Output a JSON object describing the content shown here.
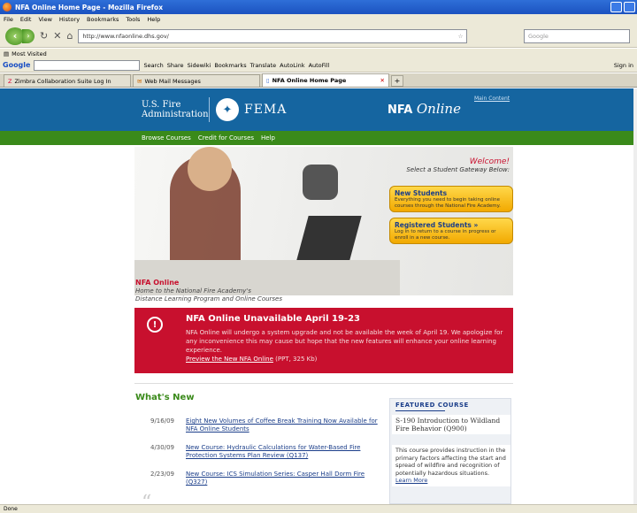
{
  "window": {
    "title": "NFA Online Home Page - Mozilla Firefox"
  },
  "menu": [
    "File",
    "Edit",
    "View",
    "History",
    "Bookmarks",
    "Tools",
    "Help"
  ],
  "nav": {
    "url": "http://www.nfaonline.dhs.gov/",
    "search_placeholder": "Google"
  },
  "bookmarks": {
    "most_visited": "Most Visited"
  },
  "googlebar": {
    "logo": "Google",
    "tools": [
      "Search",
      "Share",
      "Sidewiki",
      "Bookmarks",
      "Translate",
      "AutoLink",
      "AutoFill"
    ],
    "signin": "Sign in"
  },
  "tabs": [
    {
      "label": "Zimbra Collaboration Suite Log In"
    },
    {
      "label": "Web Mail Messages"
    },
    {
      "label": "NFA Online Home Page"
    }
  ],
  "header": {
    "usfire_line1": "U.S. Fire",
    "usfire_line2": "Administration",
    "fema": "FEMA",
    "nfa_prefix": "NFA",
    "nfa_online": "Online",
    "main_content": "Main Content"
  },
  "greennav": [
    "Browse Courses",
    "Credit for Courses",
    "Help"
  ],
  "hero": {
    "welcome": "Welcome!",
    "gateway": "Select a Student Gateway Below:",
    "new_students_title": "New Students",
    "new_students_desc": "Everything you need to begin taking online courses through the National Fire Academy.",
    "registered_title": "Registered Students »",
    "registered_desc": "Log in to return to a course in progress or enroll in a new course.",
    "nfa_online": "NFA Online",
    "sub_line1": "Home to the National Fire Academy's",
    "sub_line2": "Distance Learning Program and Online Courses"
  },
  "alert": {
    "icon": "!",
    "title": "NFA Online Unavailable April 19-23",
    "body": "NFA Online will undergo a system upgrade and not be available the week of April 19. We apologize for any inconvenience this may cause but hope that the new features will enhance your online learning experience.",
    "link": "Preview the New NFA Online",
    "link_suffix": " (PPT, 325 Kb)"
  },
  "whats_new": {
    "title": "What's New",
    "items": [
      {
        "date": "9/16/09",
        "text": "Eight New Volumes of Coffee Break Training Now Available for NFA Online Students"
      },
      {
        "date": "4/30/09",
        "text": "New Course: Hydraulic Calculations for Water-Based Fire Protection Systems Plan Review (Q137)"
      },
      {
        "date": "2/23/09",
        "text": "New Course: ICS Simulation Series: Casper Hall Dorm Fire (Q327)"
      }
    ]
  },
  "featured": {
    "heading": "FEATURED COURSE",
    "title": "S-190 Introduction to Wildland Fire Behavior (Q900)",
    "desc": "This course provides instruction in the primary factors affecting the start and spread of wildfire and recognition of potentially hazardous situations.",
    "learn_more": "Learn More"
  },
  "status": {
    "text": "Done"
  }
}
